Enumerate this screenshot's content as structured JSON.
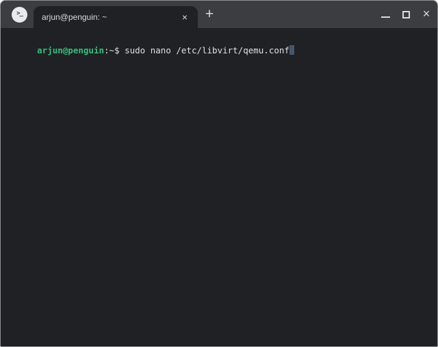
{
  "window": {
    "app_icon_glyph": ">_",
    "tab": {
      "title": "arjun@penguin: ~",
      "close_glyph": "×"
    },
    "new_tab_glyph": "+",
    "controls": {
      "close_glyph": "×"
    }
  },
  "terminal": {
    "prompt": {
      "user_host": "arjun@penguin",
      "separator": ":",
      "path": "~",
      "symbol": "$"
    },
    "command": "sudo nano /etc/libvirt/qemu.conf"
  },
  "colors": {
    "titlebar_bg": "#3c3d40",
    "terminal_bg": "#1f2124",
    "prompt_green": "#38bd7d",
    "text_default": "#dfe2e5",
    "cursor": "#44576d"
  }
}
